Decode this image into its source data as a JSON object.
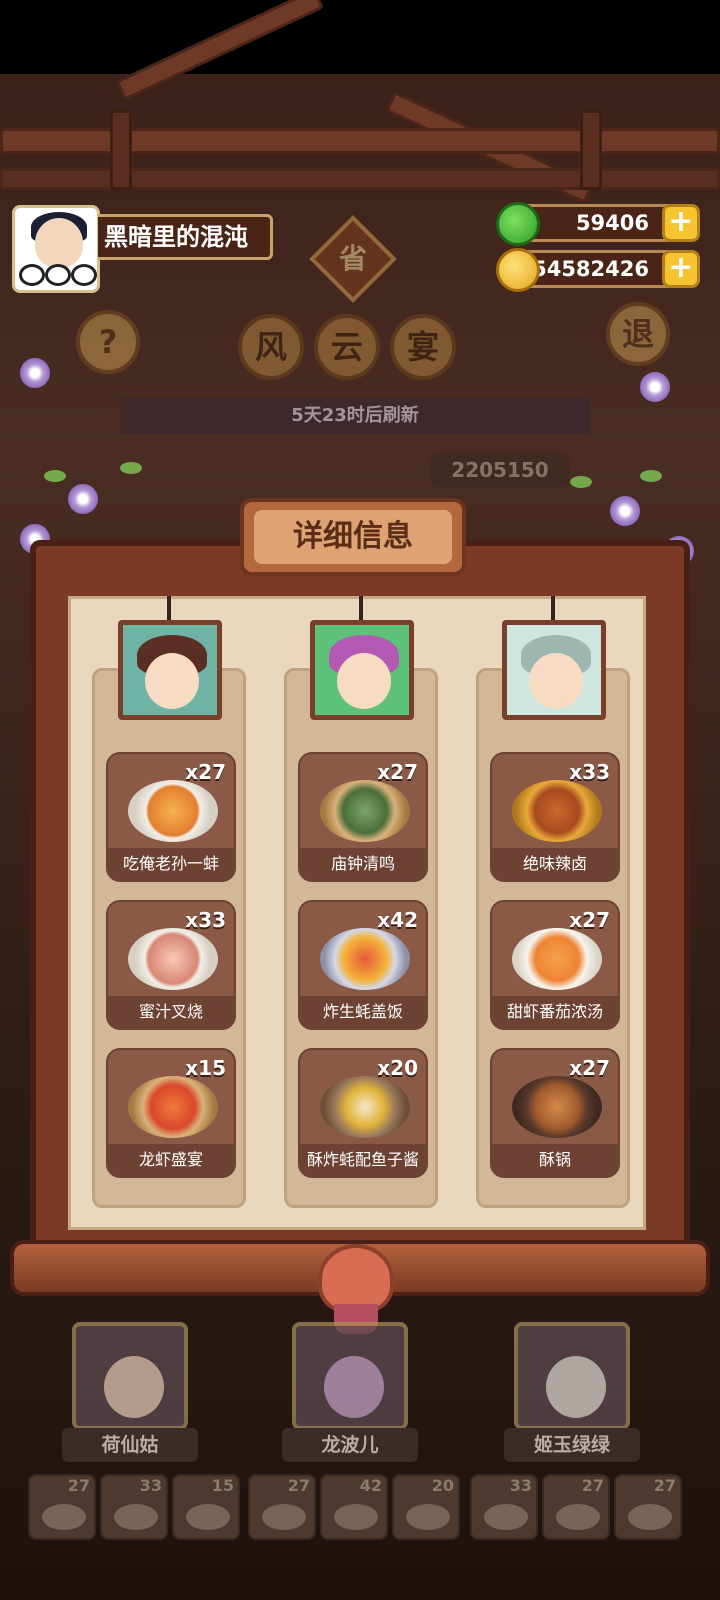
{
  "player": {
    "name": "黑暗里的混沌"
  },
  "currency": {
    "jade": "59406",
    "coins": "54582426",
    "plus": "+"
  },
  "buttons": {
    "help": "?",
    "back": "退"
  },
  "banner": {
    "badge": "省",
    "title_chars": [
      "风",
      "云",
      "宴"
    ],
    "refresh": "5天23时后刷新",
    "score": "2205150"
  },
  "panel": {
    "title": "详细信息",
    "columns": [
      {
        "character": "荷仙姑",
        "dishes": [
          {
            "name": "吃俺老孙一蚌",
            "count": "x27"
          },
          {
            "name": "蜜汁叉烧",
            "count": "x33"
          },
          {
            "name": "龙虾盛宴",
            "count": "x15"
          }
        ]
      },
      {
        "character": "龙波儿",
        "dishes": [
          {
            "name": "庙钟清鸣",
            "count": "x27"
          },
          {
            "name": "炸生蚝盖饭",
            "count": "x42"
          },
          {
            "name": "酥炸蚝配鱼子酱",
            "count": "x20"
          }
        ]
      },
      {
        "character": "姬玉绿绿",
        "dishes": [
          {
            "name": "绝味辣卤",
            "count": "x33"
          },
          {
            "name": "甜虾番茄浓汤",
            "count": "x27"
          },
          {
            "name": "酥锅",
            "count": "x27"
          }
        ]
      }
    ]
  },
  "roster": {
    "characters": [
      "荷仙姑",
      "龙波儿",
      "姬玉绿绿"
    ],
    "dish_counts": [
      "27",
      "33",
      "15",
      "27",
      "42",
      "20",
      "33",
      "27",
      "27"
    ]
  },
  "colors": {
    "frame": "#7a3a26",
    "paper": "#e8d7bd",
    "dish_card": "#8a5a47",
    "accent_gold": "#f4c431"
  },
  "icons": {
    "jade": "jade-gem-icon",
    "coin": "coin-icon",
    "plus": "plus-icon",
    "help": "question-icon",
    "back": "back-icon"
  }
}
